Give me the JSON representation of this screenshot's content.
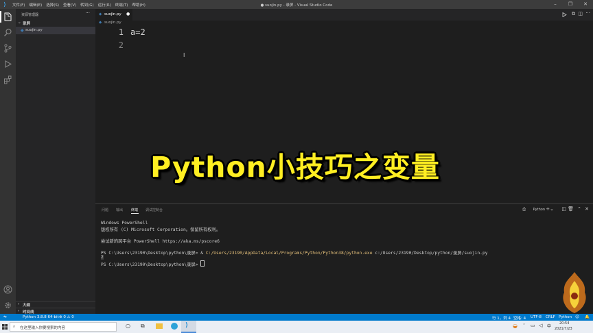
{
  "window": {
    "title": "● suojin.py - 录屏 - Visual Studio Code",
    "menu": [
      "文件(F)",
      "编辑(E)",
      "选择(S)",
      "查看(V)",
      "转到(G)",
      "运行(R)",
      "终端(T)",
      "帮助(H)"
    ]
  },
  "sidebar": {
    "header": "资源管理器",
    "folder": "录屏",
    "file": "suojin.py",
    "sections": [
      "大纲",
      "时间线"
    ]
  },
  "editor": {
    "tab_label": "suojin.py",
    "breadcrumb": "suojin.py",
    "lines": [
      {
        "num": "1",
        "text": "a=2"
      },
      {
        "num": "2",
        "text": ""
      }
    ]
  },
  "overlay_title": "Python小技巧之变量",
  "panel": {
    "tabs": [
      "问题",
      "输出",
      "终端",
      "调试控制台"
    ],
    "active_tab_index": 2,
    "shell": "Python",
    "terminal": [
      {
        "text": "Windows PowerShell"
      },
      {
        "text": "版权所有 (C) Microsoft Corporation。保留所有权利。"
      },
      {
        "text": ""
      },
      {
        "text": "尝试新的跨平台 PowerShell https://aka.ms/pscore6"
      },
      {
        "text": ""
      }
    ],
    "cmd_prompt": "PS C:\\Users\\23190\\Desktop\\python\\录屏> ",
    "cmd_amp": "& ",
    "cmd_exe": "C:/Users/23190/AppData/Local/Programs/Python/Python38/python.exe",
    "cmd_arg": " c:/Users/23190/Desktop/python/录屏/suojin.py",
    "output": "2",
    "final_prompt": "PS C:\\Users\\23190\\Desktop\\python\\录屏> "
  },
  "status": {
    "interpreter": "Python 3.8.8 64-bit",
    "problems": "⊗ 0 ⚠ 0",
    "position": "行 1，列 4",
    "spaces": "空格: 4",
    "encoding": "UTF-8",
    "eol": "CRLF",
    "language": "Python"
  },
  "taskbar": {
    "search_placeholder": "在这里输入你要搜索的内容",
    "time": "20:54",
    "date": "2021/7/23",
    "ime": "中"
  },
  "colors": {
    "statusbar": "#007acc",
    "overlay_text": "#ffee22",
    "terminal_path": "#e5c07b",
    "line_number_active": "#c6c6c6"
  }
}
